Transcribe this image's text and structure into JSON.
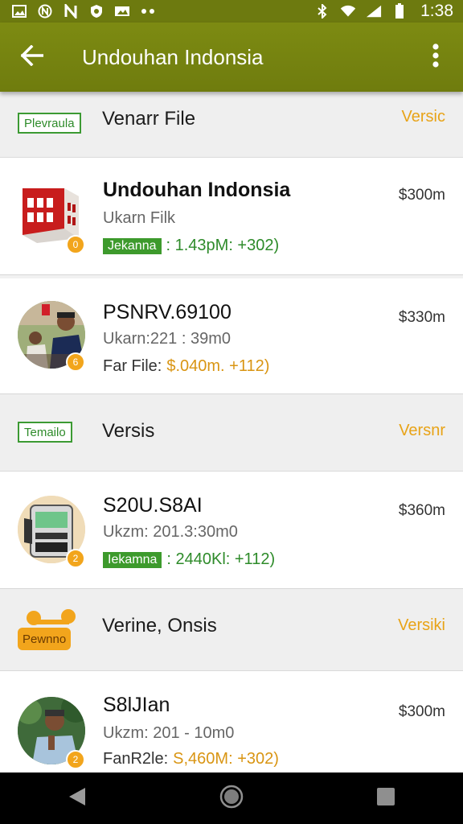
{
  "status_bar": {
    "time": "1:38",
    "icons": [
      "image-icon",
      "circle-n-icon",
      "n-icon",
      "shield-icon",
      "photo-icon",
      "dots-icon",
      "bluetooth-icon",
      "wifi-icon",
      "signal-icon",
      "battery-icon"
    ]
  },
  "app_bar": {
    "title": "Undouhan Indonsia",
    "back_icon": "arrow-left-icon",
    "menu_icon": "more-vert-icon"
  },
  "sections": [
    {
      "badge": "Plevraula",
      "title": "Venarr File",
      "action": "Versic"
    },
    {
      "badge": "Temailo",
      "title": "Versis",
      "action": "Versnr"
    },
    {
      "badge": "Pewnno",
      "title": "Verine, Onsis",
      "action": "Versiki"
    }
  ],
  "items": [
    {
      "title": "Undouhan Indonsia",
      "subtitle": "Ukarn Filk",
      "meta_tag": "Jekanna",
      "meta_value": ": 1.43pM: +302)",
      "price": "$300m",
      "dot": "0"
    },
    {
      "title": "PSNRV.69100",
      "subtitle": "Ukarn:221 : 39m0",
      "meta_label": "Far File:",
      "meta_value": "$.040m. +112)",
      "price": "$330m",
      "dot": "6"
    },
    {
      "title": "S20U.S8AI",
      "subtitle": "Ukzm: 201.3:30m0",
      "meta_tag": "Iekamna",
      "meta_value": ": 2440Kl: +112)",
      "price": "$360m",
      "dot": "2"
    },
    {
      "title": "S8lJIan",
      "subtitle": "Ukzm: 201 - 10m0",
      "meta_label": "FanR2le:",
      "meta_value": "S,460M: +302)",
      "price": "$300m",
      "dot": "2"
    }
  ],
  "nav_bar": {
    "icons": [
      "back-triangle-icon",
      "home-circle-icon",
      "recents-square-icon"
    ]
  },
  "colors": {
    "app_bar": "#7d8b12",
    "accent_orange": "#f2a51c",
    "accent_green": "#3d9a2c"
  }
}
